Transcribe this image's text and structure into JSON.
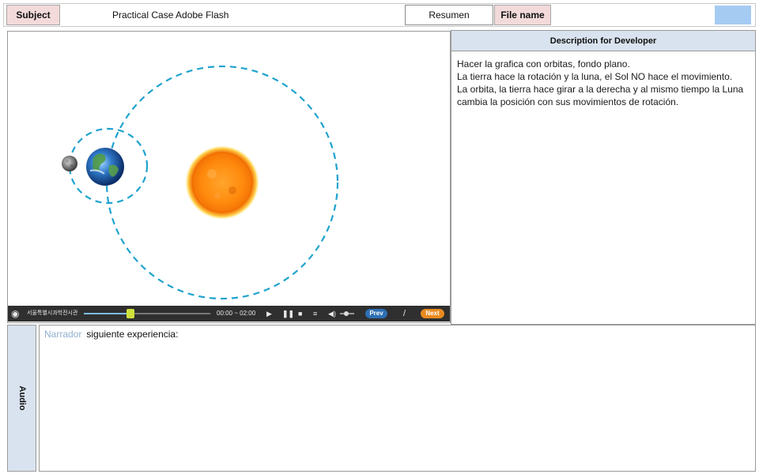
{
  "header": {
    "subject_label": "Subject",
    "subject_value": "Practical Case Adobe Flash",
    "resumen_label": "Resumen",
    "file_name_label": "File name",
    "file_name_value": ""
  },
  "player": {
    "logo_text": "서울특별시과학전시관",
    "time": "00:00 ~ 02:00",
    "prev_label": "Prev",
    "separator": "/",
    "next_label": "Next",
    "progress": 0.37,
    "volume": 0.45
  },
  "scene": {
    "objects": [
      "sun",
      "earth",
      "moon",
      "earth-orbit",
      "moon-orbit"
    ]
  },
  "description": {
    "title": "Description for Developer",
    "lines": [
      "Hacer la grafica con orbitas, fondo plano.",
      "La tierra hace la rotación y la luna, el Sol NO hace el movimiento.",
      "La orbita,  la tierra hace girar a la derecha  y al mismo tiempo la Luna cambia la posición con sus movimientos de rotación."
    ]
  },
  "audio": {
    "label": "Audio",
    "speaker": "Narrador",
    "text": "siguiente experiencia:"
  },
  "colors": {
    "subject_label_bg": "#f3dada",
    "panel_header_bg": "#d9e3ef",
    "orbit": "#1fa3cf",
    "file_swatch": "#a6cbf3",
    "player_bg": "#2f2f2f",
    "prev_pill": "#2d6fb3",
    "next_pill": "#e98a1f",
    "narrador": "#8fb0cf"
  }
}
